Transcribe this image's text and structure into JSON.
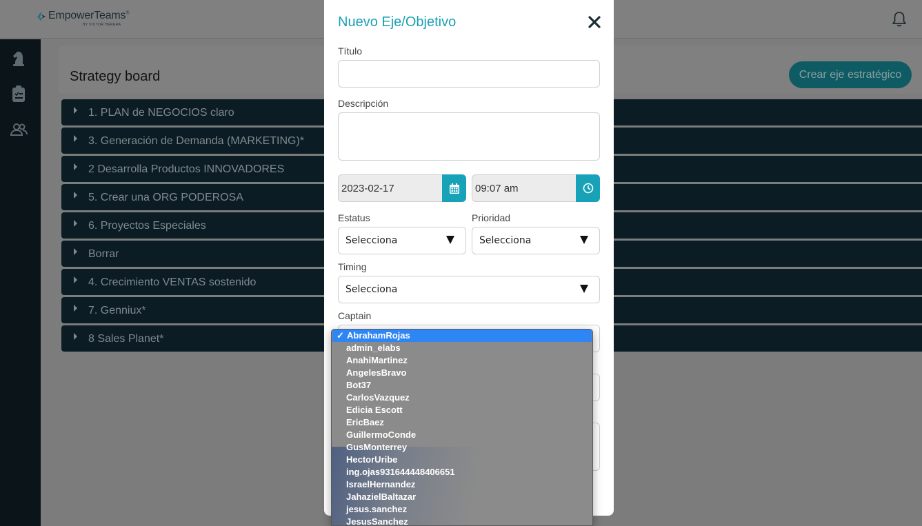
{
  "app": {
    "logo_text_1": "Empower",
    "logo_text_2": "Teams",
    "logo_mark": "®",
    "logo_sub": "BY VICTOR HERERA"
  },
  "icons": {
    "bell": "bell-icon",
    "sidebar": [
      "chess-knight-icon",
      "clipboard-icon",
      "users-icon"
    ],
    "calendar": "calendar-icon",
    "clock": "clock-icon",
    "close": "close-icon"
  },
  "colors": {
    "accent": "#17a2b8",
    "title": "#1aa0b4",
    "sidebar_bg": "#0b1418",
    "axis_bg": "#0b1c24",
    "selected_option": "#2e86f5"
  },
  "board": {
    "title": "Strategy board",
    "create_button": "Crear eje estratégico",
    "axes": [
      "1. PLAN de NEGOCIOS claro",
      "3. Generación de Demanda (MARKETING)*",
      "2 Desarrolla Productos INNOVADORES",
      "5. Crear una ORG PODEROSA",
      "6. Proyectos Especiales",
      "Borrar",
      "4. Crecimiento VENTAS sostenido",
      "7. Genniux*",
      "8 Sales Planet*"
    ]
  },
  "modal": {
    "title": "Nuevo Eje/Objetivo",
    "titulo_label": "Título",
    "descripcion_label": "Descripción",
    "date_value": "2023-02-17",
    "time_value": "09:07 am",
    "estatus_label": "Estatus",
    "estatus_value": "Selecciona",
    "prioridad_label": "Prioridad",
    "prioridad_value": "Selecciona",
    "timing_label": "Timing",
    "timing_value": "Selecciona",
    "captain_label": "Captain"
  },
  "captain_dropdown": {
    "selected": "AbrahamRojas",
    "check": "✓",
    "options": [
      "AbrahamRojas",
      "admin_elabs",
      "AnahiMartinez",
      "AngelesBravo",
      "Bot37",
      "CarlosVazquez",
      "Edicia Escott",
      "EricBaez",
      "GuillermoConde",
      "GusMonterrey",
      "HectorUribe",
      "ing.ojas931644448406651",
      "IsraelHernandez",
      "JahazielBaltazar",
      "jesus.sanchez",
      "JesusSanchez"
    ]
  }
}
